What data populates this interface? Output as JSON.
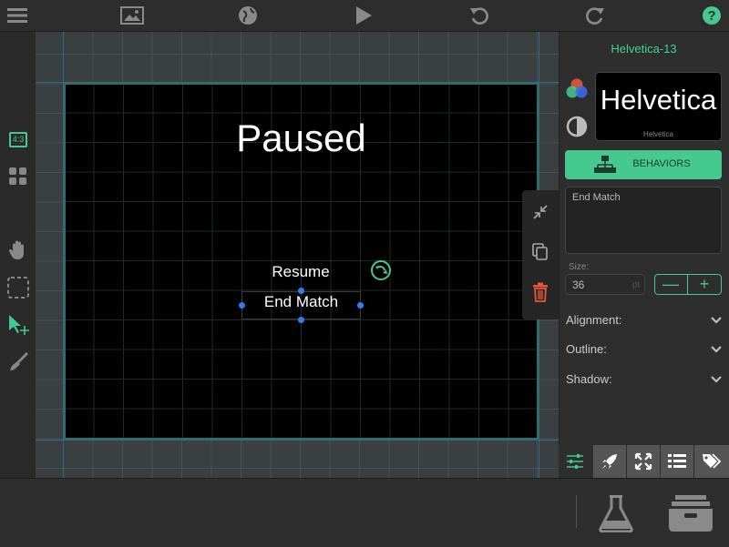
{
  "toolbar": {
    "icons": [
      "menu-icon",
      "image-icon",
      "globe-icon",
      "play-icon",
      "undo-icon",
      "redo-icon",
      "help-icon"
    ]
  },
  "left_tools": {
    "aspect_label": "4:3",
    "icons": [
      "aspect-ratio-icon",
      "grid-icon",
      "hand-icon",
      "marquee-select-icon",
      "pointer-move-icon",
      "brush-icon"
    ]
  },
  "scene": {
    "title": "Paused",
    "resume_label": "Resume",
    "end_match_label": "End Match"
  },
  "panel": {
    "font_title": "Helvetica-13",
    "preview_big": "Helvetica",
    "preview_small": "Helvetica",
    "behaviors_label": "BEHAVIORS",
    "text_value": "End Match",
    "size_label": "Size:",
    "size_value": "36",
    "size_unit": "pt",
    "minus": "—",
    "plus": "+",
    "alignment_label": "Alignment:",
    "outline_label": "Outline:",
    "shadow_label": "Shadow:"
  },
  "colors": {
    "accent": "#45c98f",
    "handle": "#2f7df6",
    "delete": "#e8553a"
  }
}
